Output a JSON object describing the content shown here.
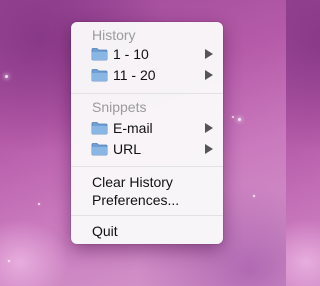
{
  "menu": {
    "history_header": "History",
    "history_items": [
      {
        "label": "1 - 10",
        "icon": "folder-icon",
        "has_submenu": true
      },
      {
        "label": "11 - 20",
        "icon": "folder-icon",
        "has_submenu": true
      }
    ],
    "snippets_header": "Snippets",
    "snippets_items": [
      {
        "label": "E-mail",
        "icon": "folder-icon",
        "has_submenu": true
      },
      {
        "label": "URL",
        "icon": "folder-icon",
        "has_submenu": true
      }
    ],
    "clear_history": "Clear History",
    "preferences": "Preferences...",
    "quit": "Quit"
  },
  "colors": {
    "menu_background": "#fafafa",
    "header_text": "#9b9b9b",
    "item_text": "#111111",
    "folder_blue": "#7ea9d8"
  }
}
